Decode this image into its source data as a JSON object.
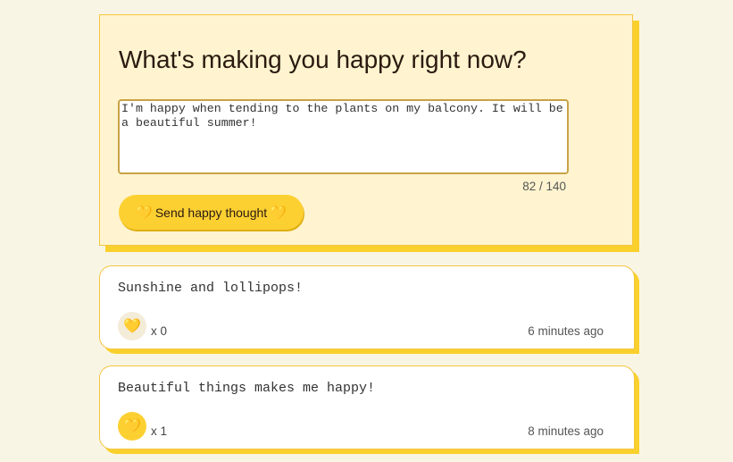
{
  "composer": {
    "title": "What's making you happy right now?",
    "input_value": "I'm happy when tending to the plants on my balcony. It will be a beautiful summer!",
    "char_count": "82 / 140",
    "send_label": "Send happy thought",
    "button_icon": "💛"
  },
  "thoughts": [
    {
      "text": "Sunshine and lollipops!",
      "like_icon": "💛",
      "likes": "x 0",
      "liked": false,
      "time": "6 minutes ago"
    },
    {
      "text": "Beautiful things makes me happy!",
      "like_icon": "💛",
      "likes": "x 1",
      "liked": true,
      "time": "8 minutes ago"
    }
  ],
  "colors": {
    "background": "#f9f5e5",
    "composer_bg": "#fff4cf",
    "accent": "#fdd032",
    "shadow": "#fad02c"
  }
}
